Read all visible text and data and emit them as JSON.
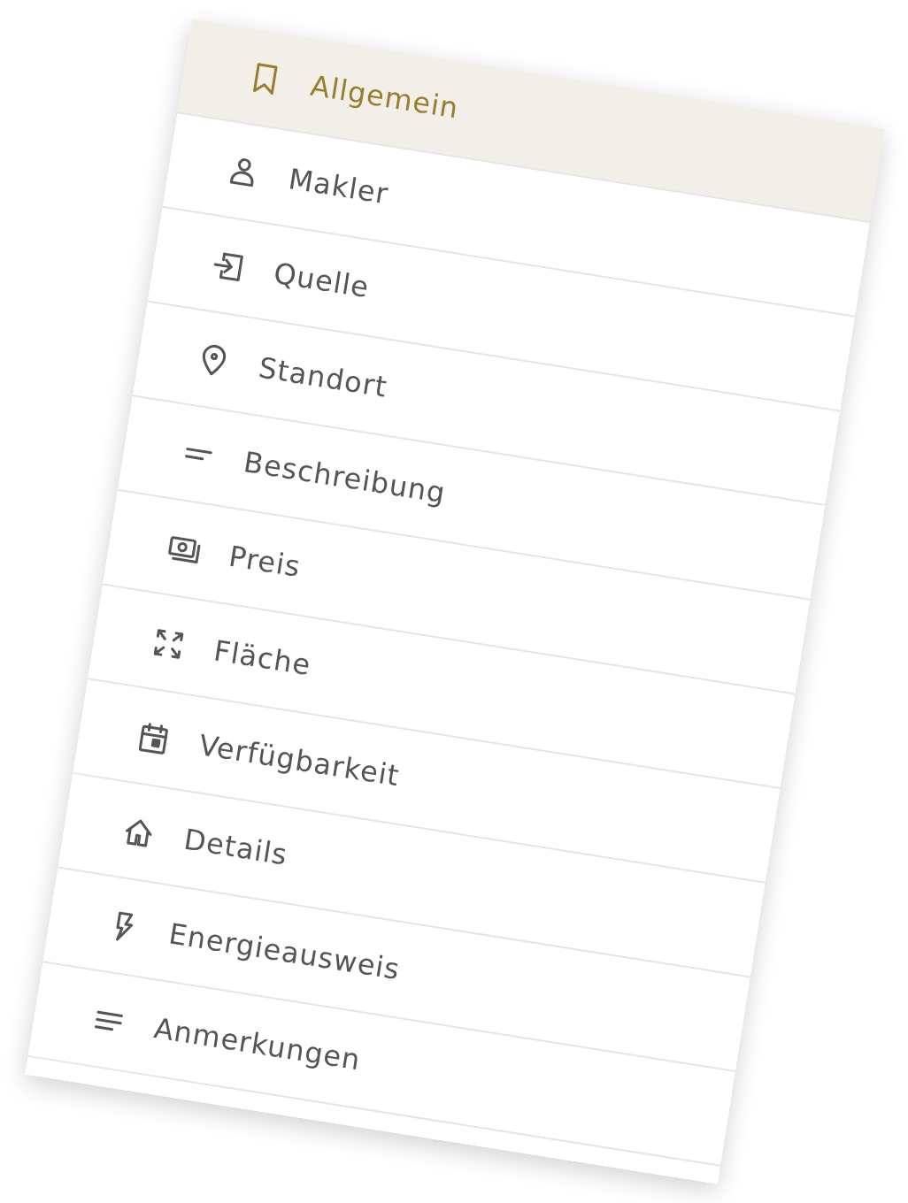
{
  "menu": {
    "items": [
      {
        "label": "Allgemein",
        "selected": true
      },
      {
        "label": "Makler",
        "selected": false
      },
      {
        "label": "Quelle",
        "selected": false
      },
      {
        "label": "Standort",
        "selected": false
      },
      {
        "label": "Beschreibung",
        "selected": false
      },
      {
        "label": "Preis",
        "selected": false
      },
      {
        "label": "Fläche",
        "selected": false
      },
      {
        "label": "Verfügbarkeit",
        "selected": false
      },
      {
        "label": "Details",
        "selected": false
      },
      {
        "label": "Energieausweis",
        "selected": false
      },
      {
        "label": "Anmerkungen",
        "selected": false
      }
    ]
  }
}
